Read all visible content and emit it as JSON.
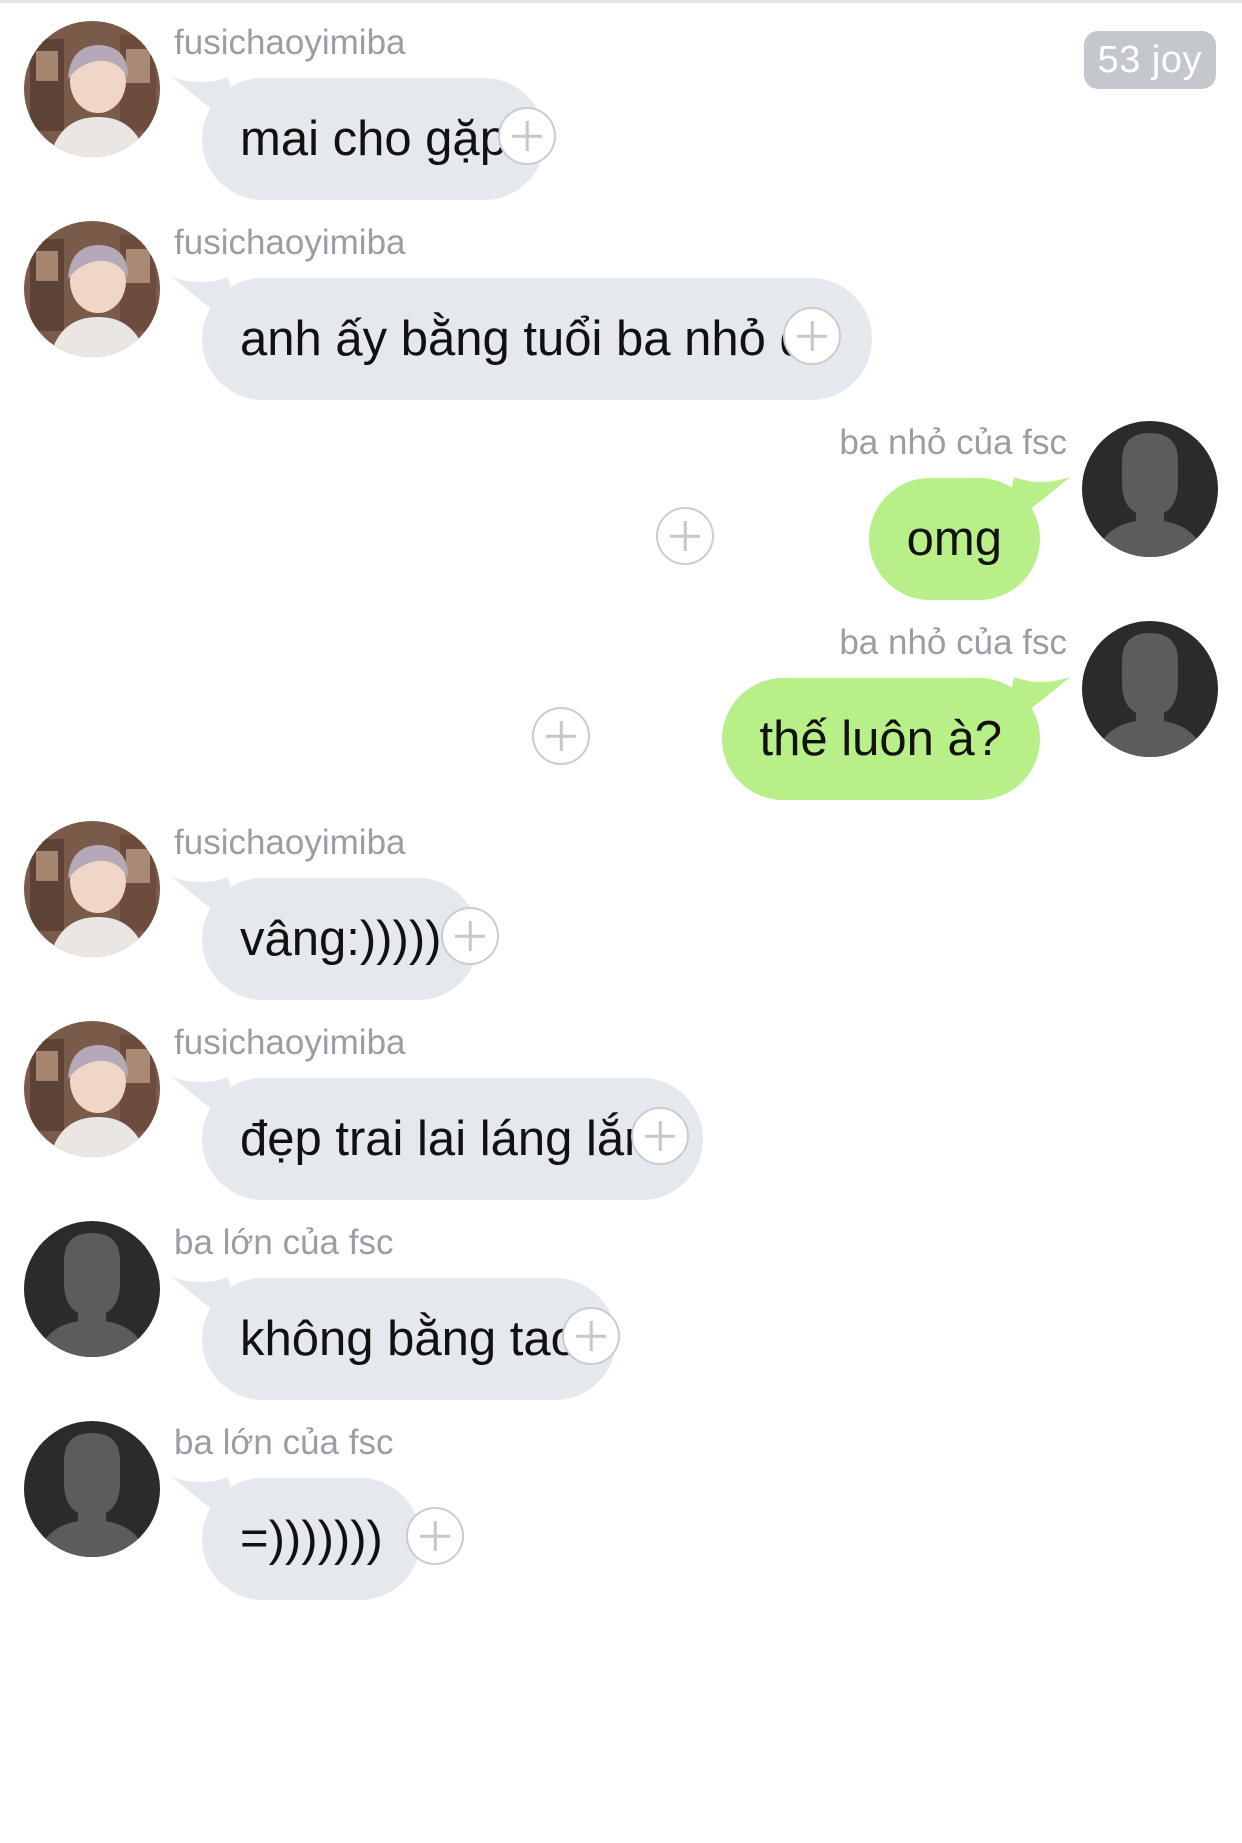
{
  "badge": {
    "label": "53 joy"
  },
  "colors": {
    "incoming_bubble": "#e5e8ec",
    "outgoing_bubble": "#b9ef88",
    "sender_name": "#9a9ea4",
    "plus_icon": "#c4c7cb",
    "badge_bg": "#c4c7cb"
  },
  "messages": [
    {
      "side": "left",
      "avatar": "photo-avatar",
      "sender": "fusichaoyimiba",
      "text": "mai cho gặp"
    },
    {
      "side": "left",
      "avatar": "photo-avatar",
      "sender": "fusichaoyimiba",
      "text": "anh ấy bằng tuổi ba nhỏ đó"
    },
    {
      "side": "right",
      "avatar": "default-avatar",
      "sender": "ba nhỏ của fsc",
      "text": "omg"
    },
    {
      "side": "right",
      "avatar": "default-avatar",
      "sender": "ba nhỏ của fsc",
      "text": "thế luôn à?"
    },
    {
      "side": "left",
      "avatar": "photo-avatar",
      "sender": "fusichaoyimiba",
      "text": "vâng:)))))"
    },
    {
      "side": "left",
      "avatar": "photo-avatar",
      "sender": "fusichaoyimiba",
      "text": "đẹp trai lai láng lắm"
    },
    {
      "side": "left",
      "avatar": "default-avatar",
      "sender": "ba lớn của fsc",
      "text": "không bằng tao"
    },
    {
      "side": "left",
      "avatar": "default-avatar",
      "sender": "ba lớn của fsc",
      "text": "=)))))))"
    }
  ]
}
